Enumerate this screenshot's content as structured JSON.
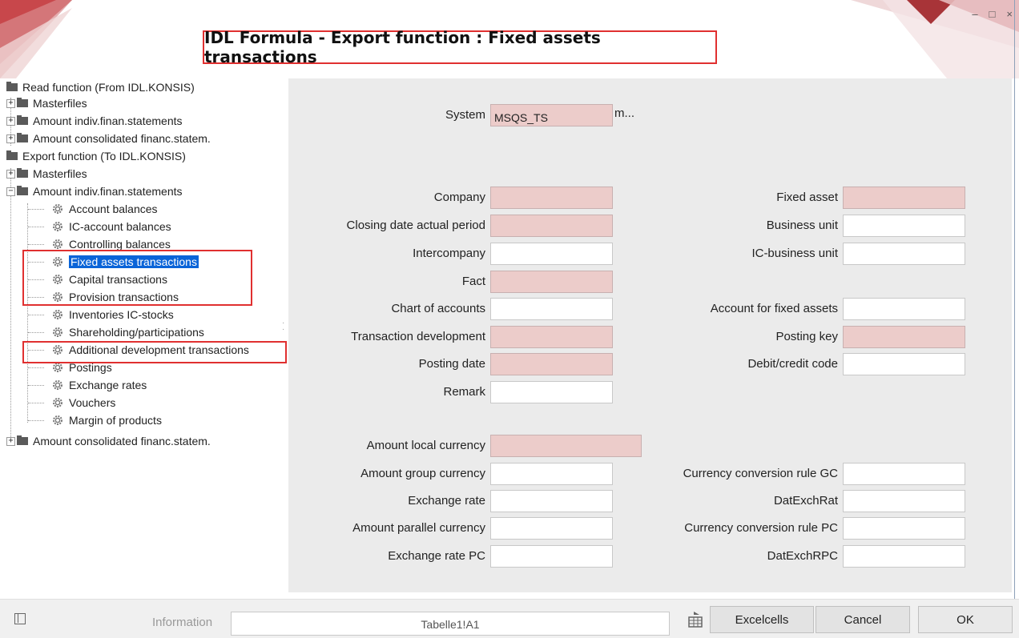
{
  "window": {
    "title": "IDL Formula - Export function : Fixed assets transactions",
    "controls": {
      "minimize": "–",
      "maximize": "□",
      "close": "×"
    }
  },
  "tree": {
    "read_root": "Read function (From IDL.KONSIS)",
    "read_children": [
      "Masterfiles",
      "Amount indiv.finan.statements",
      "Amount consolidated financ.statem."
    ],
    "export_root": "Export function (To IDL.KONSIS)",
    "export_masterfiles": "Masterfiles",
    "export_amount_indiv": "Amount indiv.finan.statements",
    "export_leaves": [
      "Account balances",
      "IC-account balances",
      "Controlling balances",
      "Fixed assets transactions",
      "Capital transactions",
      "Provision transactions",
      "Inventories IC-stocks",
      "Shareholding/participations",
      "Additional development transactions",
      "Postings",
      "Exchange rates",
      "Vouchers",
      "Margin of products"
    ],
    "export_amount_consolidated": "Amount consolidated financ.statem.",
    "selected": "Fixed assets transactions"
  },
  "form": {
    "system_label": "System",
    "system_value": "MSQS_TS",
    "system_more": "m...",
    "left_fields": [
      {
        "label": "Company",
        "value": ""
      },
      {
        "label": "Closing date actual period",
        "value": ""
      },
      {
        "label": "Intercompany",
        "value": ""
      },
      {
        "label": "Fact",
        "value": ""
      },
      {
        "label": "Chart of accounts",
        "value": ""
      },
      {
        "label": "Transaction development",
        "value": ""
      },
      {
        "label": "Posting date",
        "value": ""
      },
      {
        "label": "Remark",
        "value": ""
      }
    ],
    "right_fields": [
      {
        "label": "Fixed asset",
        "value": ""
      },
      {
        "label": "Business unit",
        "value": ""
      },
      {
        "label": "IC-business unit",
        "value": ""
      },
      {
        "label": "Account for fixed assets",
        "value": ""
      },
      {
        "label": "Posting key",
        "value": ""
      },
      {
        "label": "Debit/credit code",
        "value": ""
      }
    ],
    "amount_local_label": "Amount local currency",
    "amount_left": [
      {
        "label": "Amount group currency",
        "value": ""
      },
      {
        "label": "Exchange rate",
        "value": ""
      },
      {
        "label": "Amount parallel currency",
        "value": ""
      },
      {
        "label": "Exchange rate PC",
        "value": ""
      }
    ],
    "amount_right": [
      {
        "label": "Currency conversion rule GC",
        "value": ""
      },
      {
        "label": "DatExchRat",
        "value": ""
      },
      {
        "label": "Currency conversion rule PC",
        "value": ""
      },
      {
        "label": "DatExchRPC",
        "value": ""
      }
    ]
  },
  "bottom": {
    "information_label": "Information",
    "information_value": "Tabelle1!A1",
    "excelcells_label": "Excelcells",
    "cancel_label": "Cancel",
    "ok_label": "OK"
  },
  "colors": {
    "selection": "#0a64d8",
    "highlight_box": "#e03030",
    "readonly_field": "#ecccca",
    "form_background": "#ebebeb"
  }
}
